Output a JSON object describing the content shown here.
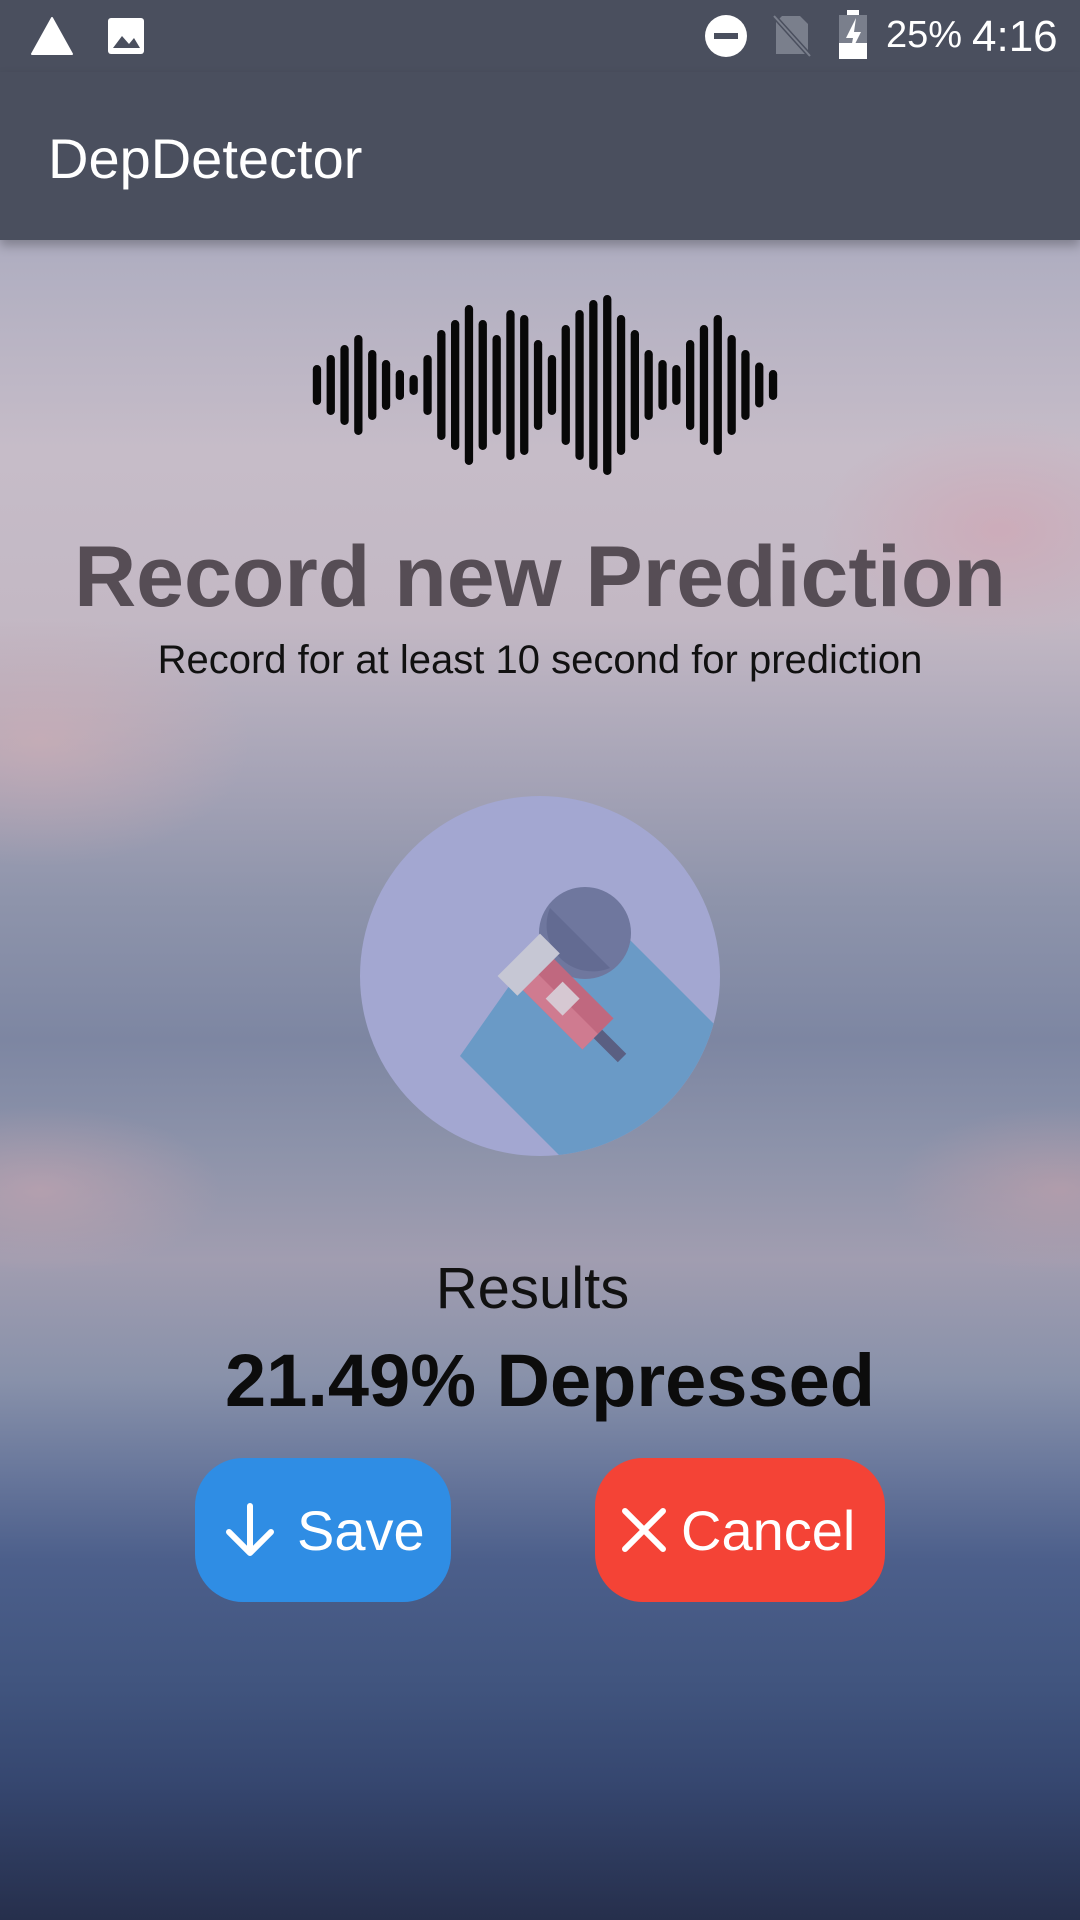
{
  "status_bar": {
    "battery_percent": "25%",
    "time": "4:16",
    "icons": [
      "alert-triangle-icon",
      "image-icon",
      "do-not-disturb-icon",
      "no-sim-icon",
      "battery-charging-icon"
    ]
  },
  "app_bar": {
    "title": "DepDetector"
  },
  "record": {
    "title": "Record new Prediction",
    "subtitle": "Record for at least 10 second for prediction",
    "mic_icon": "microphone-icon",
    "waveform_icon": "sound-wave-icon"
  },
  "results": {
    "label": "Results",
    "value": "21.49% Depressed"
  },
  "actions": {
    "save_label": "Save",
    "save_icon": "arrow-down-icon",
    "save_color": "#2f8de4",
    "cancel_label": "Cancel",
    "cancel_icon": "close-icon",
    "cancel_color": "#f44336"
  },
  "colors": {
    "app_bar": "#4a4f5e",
    "heading": "#564d55"
  }
}
